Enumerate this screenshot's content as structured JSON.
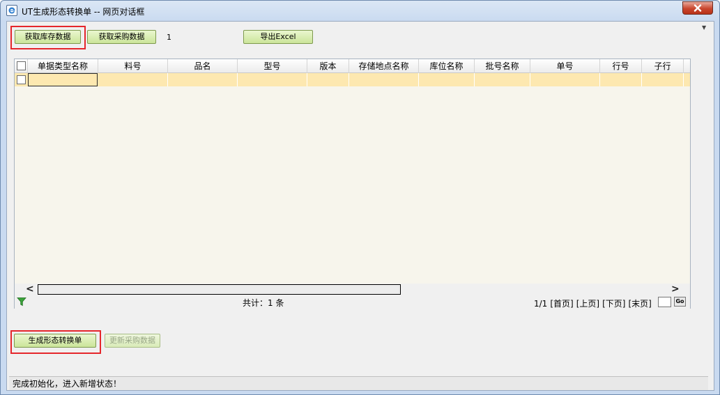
{
  "window": {
    "title": "UT生成形态转换单 -- 网页对话框"
  },
  "toolbar": {
    "get_stock_label": "获取库存数据",
    "get_purchase_label": "获取采购数据",
    "count": "1",
    "export_label": "导出Excel"
  },
  "grid": {
    "columns": [
      "单据类型名称",
      "料号",
      "品名",
      "型号",
      "版本",
      "存储地点名称",
      "库位名称",
      "批号名称",
      "单号",
      "行号",
      "子行"
    ],
    "rows": [
      [
        "",
        "",
        "",
        "",
        "",
        "",
        "",
        "",
        "",
        "",
        ""
      ]
    ],
    "total": "共计：1 条",
    "pager": {
      "page_info": "1/1",
      "first": "[首页]",
      "prev": "[上页]",
      "next": "[下页]",
      "last": "[末页]",
      "go": "Go",
      "page_input": ""
    }
  },
  "actions": {
    "generate_label": "生成形态转换单",
    "update_purchase_label": "更新采购数据"
  },
  "status": {
    "text": "完成初始化，进入新增状态！"
  },
  "icons": {
    "window_icon": "ie-page-icon",
    "close": "close-icon",
    "filter": "filter-icon",
    "scroll_left": "chevron-left-icon",
    "scroll_right": "chevron-right-icon"
  },
  "colors": {
    "button_bg": "#cbe59a",
    "row_highlight": "#fde8b0",
    "annotation_border": "#e5262b",
    "close_button": "#c9462e"
  }
}
